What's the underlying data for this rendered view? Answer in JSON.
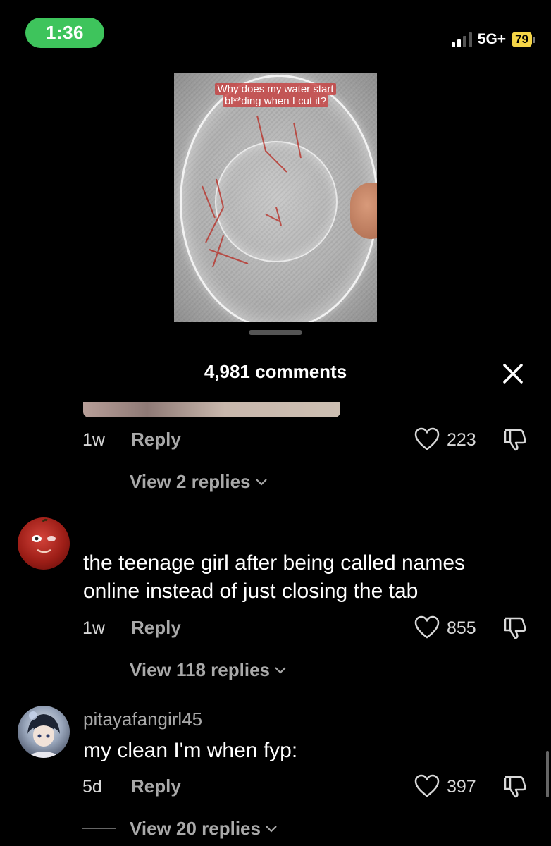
{
  "status_bar": {
    "time": "1:36",
    "network": "5G+",
    "battery": "79",
    "time_pill_color": "#3ec45c",
    "battery_color": "#f5d547"
  },
  "video": {
    "caption_line1": "Why does my water start",
    "caption_line2": "bl**ding when I cut it?"
  },
  "comments_header": {
    "count_label": "4,981 comments",
    "close_icon": "close-icon"
  },
  "comments": [
    {
      "age": "1w",
      "reply_label": "Reply",
      "likes": "223",
      "view_replies": "View 2 replies"
    },
    {
      "avatar_icon": "apple-avatar",
      "text_line1": "the teenage girl after being called names",
      "text_line2": "online instead of just closing the tab",
      "age": "1w",
      "reply_label": "Reply",
      "likes": "855",
      "view_replies": "View 118 replies"
    },
    {
      "avatar_icon": "anime-avatar",
      "username": "pitayafangirl45",
      "text": "my clean I'm when fyp:",
      "age": "5d",
      "reply_label": "Reply",
      "likes": "397",
      "view_replies": "View 20 replies"
    }
  ]
}
